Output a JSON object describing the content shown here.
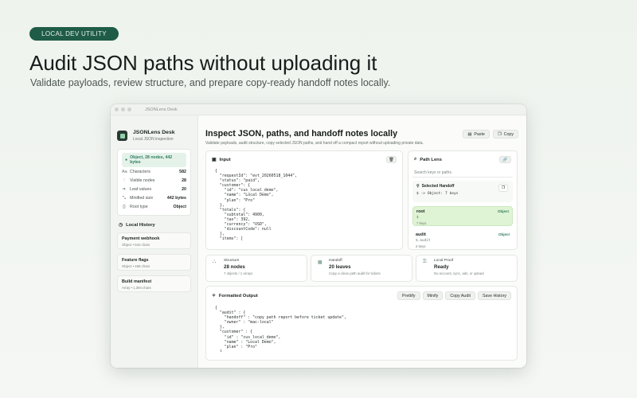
{
  "hero": {
    "pill": "LOCAL DEV UTILITY",
    "title": "Audit JSON paths without uploading it",
    "subtitle": "Validate payloads, review structure, and prepare copy-ready handoff notes locally."
  },
  "window": {
    "title": "JSONLens Desk"
  },
  "app": {
    "name": "JSONLens Desk",
    "tagline": "Local JSON inspection"
  },
  "stats": {
    "summary": "Object, 28 nodes, 442 bytes",
    "rows": [
      {
        "label": "Characters",
        "value": "582",
        "icon": "characters-icon"
      },
      {
        "label": "Visible nodes",
        "value": "28",
        "icon": "nodes-icon"
      },
      {
        "label": "Leaf values",
        "value": "20",
        "icon": "leaf-icon"
      },
      {
        "label": "Minified size",
        "value": "442 bytes",
        "icon": "size-icon"
      },
      {
        "label": "Root type",
        "value": "Object",
        "icon": "braces-icon"
      }
    ]
  },
  "history": {
    "title": "Local History",
    "items": [
      {
        "title": "Payment webhook",
        "meta": "Object • 842 chars"
      },
      {
        "title": "Feature flags",
        "meta": "Object • 458 chars"
      },
      {
        "title": "Build manifest",
        "meta": "Array • 1,394 chars"
      }
    ]
  },
  "main": {
    "title": "Inspect JSON, paths, and handoff notes locally",
    "subtitle": "Validate payloads, audit structure, copy selected JSON paths, and hand off a compact report without uploading private data.",
    "paste_label": "Paste",
    "copy_label": "Copy"
  },
  "input": {
    "title": "Input",
    "code": "{\n  \"requestId\": \"evt_20260518_1044\",\n  \"status\": \"paid\",\n  \"customer\": {\n    \"id\": \"cus_local_demo\",\n    \"name\": \"Local Demo\",\n    \"plan\": \"Pro\"\n  },\n  \"totals\": {\n    \"subtotal\": 4900,\n    \"tax\": 392,\n    \"currency\": \"USD\",\n    \"discountCode\": null\n  },\n  \"items\": ["
  },
  "lens": {
    "title": "Path Lens",
    "search_placeholder": "Search keys or paths",
    "selected_title": "Selected Handoff",
    "selected_value": "$ -> Object: 7 keys",
    "paths": [
      {
        "name": "root",
        "path": "$",
        "keys": "7 keys",
        "type": "Object"
      },
      {
        "name": "audit",
        "path": "$.audit",
        "keys": "2 keys",
        "type": "Object"
      }
    ]
  },
  "cards": [
    {
      "title": "Structure",
      "value": "28 nodes",
      "meta": "7 objects / 1 arrays",
      "icon": "structure-icon"
    },
    {
      "title": "Handoff",
      "value": "20 leaves",
      "meta": "Copy a clean path audit for tickets",
      "icon": "handoff-icon"
    },
    {
      "title": "Local Proof",
      "value": "Ready",
      "meta": "No account, sync, ads, or upload",
      "icon": "lock-icon"
    }
  ],
  "output": {
    "title": "Formatted Output",
    "buttons": [
      "Prettify",
      "Minify",
      "Copy Audit",
      "Save History"
    ],
    "code": "{\n  \"audit\" : {\n    \"handoff\" : \"copy path report before ticket update\",\n    \"owner\" : \"mac-local\"\n  },\n  \"customer\" : {\n    \"id\" : \"cus_local_demo\",\n    \"name\" : \"Local Demo\",\n    \"plan\" : \"Pro\"\n  },\n  \"items\" : [\n    {"
  }
}
